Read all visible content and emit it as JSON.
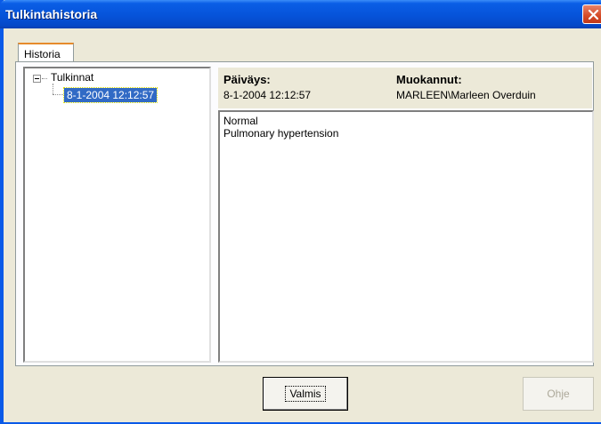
{
  "window": {
    "title": "Tulkintahistoria"
  },
  "tabs": [
    {
      "label": "Historia"
    }
  ],
  "tree": {
    "root_label": "Tulkinnat",
    "items": [
      {
        "label": "8-1-2004 12:12:57",
        "selected": true
      }
    ]
  },
  "details": {
    "date_label": "Päiväys:",
    "date_value": "8-1-2004 12:12:57",
    "modified_label": "Muokannut:",
    "modified_value": "MARLEEN\\Marleen Overduin"
  },
  "content": {
    "lines": [
      "Normal",
      "Pulmonary hypertension"
    ]
  },
  "buttons": {
    "ok_label": "Valmis",
    "help_label": "Ohje"
  },
  "colors": {
    "titlebar": "#0653d9",
    "close_button": "#d44a26",
    "selection": "#316ac5"
  }
}
